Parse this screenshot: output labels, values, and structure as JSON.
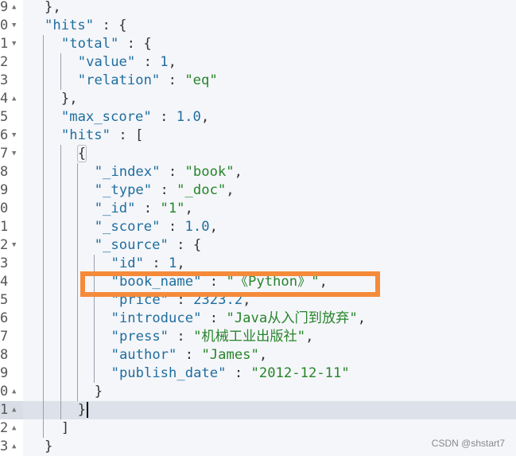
{
  "editor": {
    "lines": [
      {
        "num": "9",
        "fold": "up",
        "indent": 0,
        "guides": 0,
        "tokens": [
          [
            "p",
            "},"
          ]
        ]
      },
      {
        "num": "0",
        "fold": "down",
        "indent": 0,
        "guides": 0,
        "tokens": [
          [
            "k",
            "\"hits\""
          ],
          [
            "p",
            " : {"
          ]
        ]
      },
      {
        "num": "1",
        "fold": "down",
        "indent": 1,
        "guides": 1,
        "tokens": [
          [
            "k",
            "\"total\""
          ],
          [
            "p",
            " : {"
          ]
        ]
      },
      {
        "num": "2",
        "fold": "",
        "indent": 2,
        "guides": 2,
        "tokens": [
          [
            "k",
            "\"value\""
          ],
          [
            "p",
            " : "
          ],
          [
            "n",
            "1"
          ],
          [
            "p",
            ","
          ]
        ]
      },
      {
        "num": "3",
        "fold": "",
        "indent": 2,
        "guides": 2,
        "tokens": [
          [
            "k",
            "\"relation\""
          ],
          [
            "p",
            " : "
          ],
          [
            "s",
            "\"eq\""
          ]
        ]
      },
      {
        "num": "4",
        "fold": "up",
        "indent": 1,
        "guides": 1,
        "tokens": [
          [
            "p",
            "},"
          ]
        ]
      },
      {
        "num": "5",
        "fold": "",
        "indent": 1,
        "guides": 1,
        "tokens": [
          [
            "k",
            "\"max_score\""
          ],
          [
            "p",
            " : "
          ],
          [
            "n",
            "1.0"
          ],
          [
            "p",
            ","
          ]
        ]
      },
      {
        "num": "6",
        "fold": "down",
        "indent": 1,
        "guides": 1,
        "tokens": [
          [
            "k",
            "\"hits\""
          ],
          [
            "p",
            " : ["
          ]
        ]
      },
      {
        "num": "7",
        "fold": "down",
        "indent": 2,
        "guides": 2,
        "match": true,
        "tokens": [
          [
            "p",
            "{"
          ]
        ]
      },
      {
        "num": "8",
        "fold": "",
        "indent": 3,
        "guides": 3,
        "tokens": [
          [
            "k",
            "\"_index\""
          ],
          [
            "p",
            " : "
          ],
          [
            "s",
            "\"book\""
          ],
          [
            "p",
            ","
          ]
        ]
      },
      {
        "num": "9",
        "fold": "",
        "indent": 3,
        "guides": 3,
        "tokens": [
          [
            "k",
            "\"_type\""
          ],
          [
            "p",
            " : "
          ],
          [
            "s",
            "\"_doc\""
          ],
          [
            "p",
            ","
          ]
        ]
      },
      {
        "num": "0",
        "fold": "",
        "indent": 3,
        "guides": 3,
        "tokens": [
          [
            "k",
            "\"_id\""
          ],
          [
            "p",
            " : "
          ],
          [
            "s",
            "\"1\""
          ],
          [
            "p",
            ","
          ]
        ]
      },
      {
        "num": "1",
        "fold": "",
        "indent": 3,
        "guides": 3,
        "tokens": [
          [
            "k",
            "\"_score\""
          ],
          [
            "p",
            " : "
          ],
          [
            "n",
            "1.0"
          ],
          [
            "p",
            ","
          ]
        ]
      },
      {
        "num": "2",
        "fold": "down",
        "indent": 3,
        "guides": 3,
        "tokens": [
          [
            "k",
            "\"_source\""
          ],
          [
            "p",
            " : {"
          ]
        ]
      },
      {
        "num": "3",
        "fold": "",
        "indent": 4,
        "guides": 4,
        "tokens": [
          [
            "k",
            "\"id\""
          ],
          [
            "p",
            " : "
          ],
          [
            "n",
            "1"
          ],
          [
            "p",
            ","
          ]
        ]
      },
      {
        "num": "4",
        "fold": "",
        "indent": 4,
        "guides": 4,
        "tokens": [
          [
            "k",
            "\"book_name\""
          ],
          [
            "p",
            " : "
          ],
          [
            "s",
            "\"《Python》\""
          ],
          [
            "p",
            ","
          ]
        ]
      },
      {
        "num": "5",
        "fold": "",
        "indent": 4,
        "guides": 4,
        "tokens": [
          [
            "k",
            "\"price\""
          ],
          [
            "p",
            " : "
          ],
          [
            "n",
            "2323.2"
          ],
          [
            "p",
            ","
          ]
        ]
      },
      {
        "num": "6",
        "fold": "",
        "indent": 4,
        "guides": 4,
        "tokens": [
          [
            "k",
            "\"introduce\""
          ],
          [
            "p",
            " : "
          ],
          [
            "s",
            "\"Java从入门到放弃\""
          ],
          [
            "p",
            ","
          ]
        ]
      },
      {
        "num": "7",
        "fold": "",
        "indent": 4,
        "guides": 4,
        "tokens": [
          [
            "k",
            "\"press\""
          ],
          [
            "p",
            " : "
          ],
          [
            "s",
            "\"机械工业出版社\""
          ],
          [
            "p",
            ","
          ]
        ]
      },
      {
        "num": "8",
        "fold": "",
        "indent": 4,
        "guides": 4,
        "tokens": [
          [
            "k",
            "\"author\""
          ],
          [
            "p",
            " : "
          ],
          [
            "s",
            "\"James\""
          ],
          [
            "p",
            ","
          ]
        ]
      },
      {
        "num": "9",
        "fold": "",
        "indent": 4,
        "guides": 4,
        "tokens": [
          [
            "k",
            "\"publish_date\""
          ],
          [
            "p",
            " : "
          ],
          [
            "s",
            "\"2012-12-11\""
          ]
        ]
      },
      {
        "num": "0",
        "fold": "up",
        "indent": 3,
        "guides": 3,
        "tokens": [
          [
            "p",
            "}"
          ]
        ]
      },
      {
        "num": "1",
        "fold": "up",
        "indent": 2,
        "guides": 2,
        "active": true,
        "cursor": true,
        "tokens": [
          [
            "p",
            "}"
          ]
        ]
      },
      {
        "num": "2",
        "fold": "up",
        "indent": 1,
        "guides": 1,
        "tokens": [
          [
            "p",
            "]"
          ]
        ]
      },
      {
        "num": "3",
        "fold": "up",
        "indent": 0,
        "guides": 0,
        "tokens": [
          [
            "p",
            "}"
          ]
        ]
      }
    ],
    "highlighted_field": "book_name"
  },
  "colors": {
    "key": "#1f6e9e",
    "string": "#26852a",
    "number": "#1f6e9e",
    "highlight_box": "#f58b3a",
    "active_line": "#dde2ea"
  },
  "icons": {
    "fold_up": "▲",
    "fold_down": "▼"
  },
  "watermark": "CSDN @shstart7"
}
